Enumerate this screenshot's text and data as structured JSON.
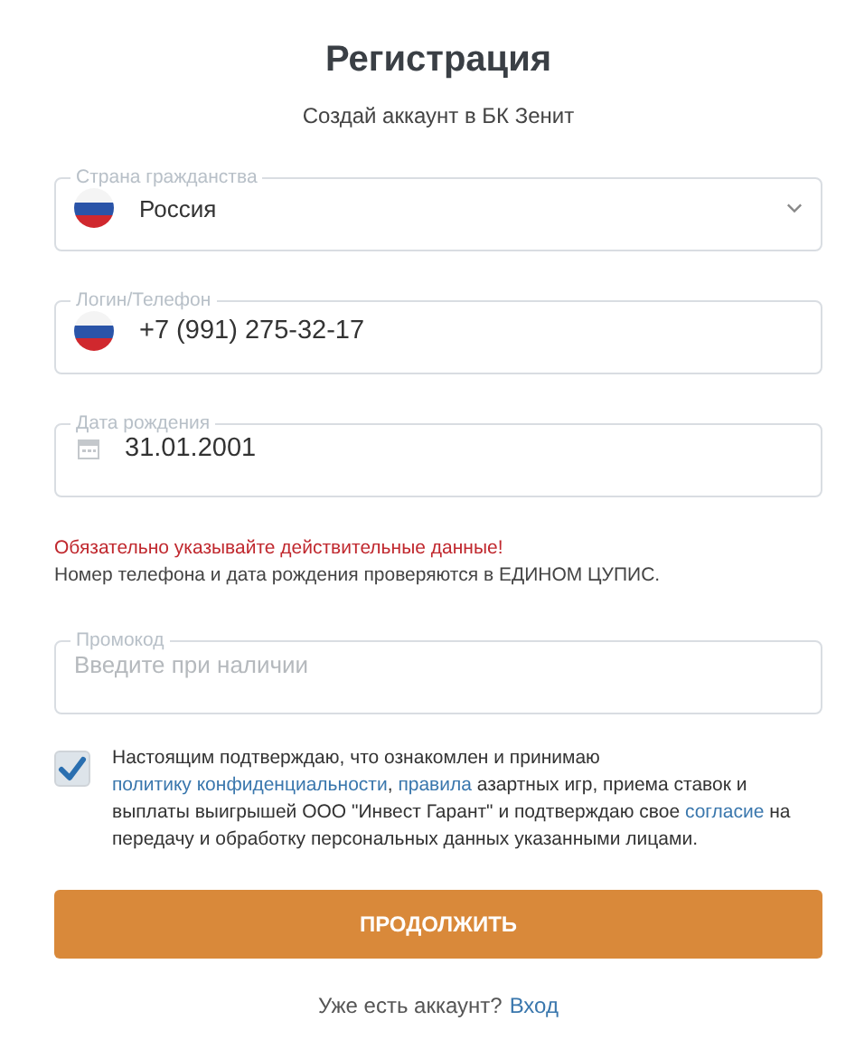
{
  "title": "Регистрация",
  "subtitle": "Создай аккаунт в БК Зенит",
  "fields": [
    {
      "kind": "select",
      "label": "Страна гражданства",
      "value": "Россия"
    },
    {
      "kind": "phone",
      "label": "Логин/Телефон",
      "value": "+7 (991) 275-32-17"
    },
    {
      "kind": "date",
      "label": "Дата рождения",
      "value": "31.01.2001"
    }
  ],
  "warning": "Обязательно указывайте действительные данные!",
  "note": "Номер телефона и дата рождения проверяются в ЕДИНОМ ЦУПИС.",
  "promo": {
    "label": "Промокод",
    "placeholder": "Введите при наличии"
  },
  "consent": {
    "checked": true,
    "parts": [
      {
        "kind": "text",
        "text": "Настоящим подтверждаю, что ознакомлен и принимаю "
      },
      {
        "kind": "link",
        "text": "политику конфиденциальности"
      },
      {
        "kind": "text",
        "text": ", "
      },
      {
        "kind": "link",
        "text": "правила"
      },
      {
        "kind": "text",
        "text": " азартных игр, приема ставок и выплаты выигрышей ООО \"Инвест Гарант\" и подтверждаю свое "
      },
      {
        "kind": "link",
        "text": "согласие"
      },
      {
        "kind": "text",
        "text": " на передачу и обработку персональных данных указанными лицами."
      }
    ]
  },
  "submit": "ПРОДОЛЖИТЬ",
  "footer": {
    "text": "Уже есть аккаунт?",
    "link": "Вход"
  }
}
